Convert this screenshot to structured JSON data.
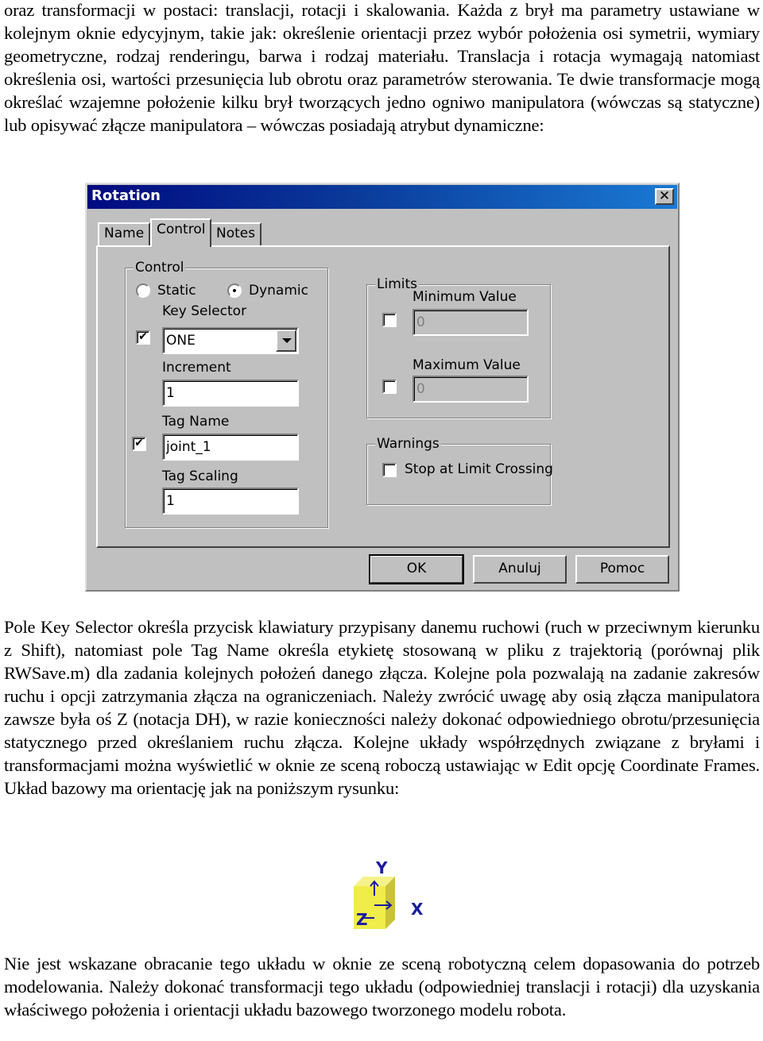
{
  "paragraphs": {
    "intro": "oraz transformacji w postaci: translacji, rotacji i skalowania. Każda z brył ma parametry ustawiane w kolejnym oknie edycyjnym, takie jak: określenie orientacji przez wybór położenia osi symetrii, wymiary geometryczne, rodzaj renderingu, barwa i rodzaj materiału. Translacja i rotacja wymagają natomiast określenia osi, wartości przesunięcia lub obrotu oraz parametrów sterowania. Te dwie transformacje mogą określać wzajemne położenie kilku brył tworzących jedno ogniwo manipulatora (wówczas są statyczne) lub opisywać złącze manipulatora – wówczas posiadają atrybut dynamiczne:",
    "key_selector": "Pole Key Selector określa przycisk klawiatury przypisany danemu ruchowi (ruch w przeciwnym kierunku z Shift), natomiast pole Tag Name określa etykietę stosowaną w pliku z trajektorią (porównaj plik RWSave.m) dla zadania kolejnych położeń danego złącza. Kolejne pola pozwalają na zadanie zakresów ruchu i opcji zatrzymania złącza na ograniczeniach. Należy zwrócić uwagę aby osią złącza manipulatora zawsze była oś Z (notacja DH), w razie konieczności należy dokonać odpowiedniego obrotu/przesunięcia statycznego przed określaniem ruchu złącza. Kolejne układy współrzędnych związane z bryłami i transformacjami można wyświetlić w oknie ze sceną roboczą ustawiając w Edit opcję Coordinate Frames. Układ bazowy ma orientację jak na poniższym rysunku:",
    "closing": "Nie jest wskazane obracanie tego układu w oknie ze sceną robotyczną celem dopasowania do potrzeb modelowania. Należy dokonać transformacji tego układu (odpowiedniej translacji i rotacji) dla uzyskania właściwego położenia i orientacji układu bazowego tworzonego modelu robota."
  },
  "dialog": {
    "title": "Rotation",
    "close_icon": "close-icon",
    "tabs": [
      {
        "label": "Name",
        "active": false
      },
      {
        "label": "Control",
        "active": true
      },
      {
        "label": "Notes",
        "active": false
      }
    ],
    "control_group": {
      "legend": "Control",
      "radio_static": {
        "label": "Static",
        "selected": false
      },
      "radio_dynamic": {
        "label": "Dynamic",
        "selected": true
      },
      "key_selector": {
        "label": "Key Selector",
        "checked": true,
        "value": "ONE"
      },
      "increment": {
        "label": "Increment",
        "value": "1"
      },
      "tag_name": {
        "label": "Tag Name",
        "checked": true,
        "value": "joint_1"
      },
      "tag_scaling": {
        "label": "Tag Scaling",
        "value": "1"
      }
    },
    "limits_group": {
      "legend": "Limits",
      "minimum": {
        "label": "Minimum Value",
        "checked": false,
        "value": "0"
      },
      "maximum": {
        "label": "Maximum Value",
        "checked": false,
        "value": "0"
      }
    },
    "warnings_group": {
      "legend": "Warnings",
      "stop_at_limit": {
        "label": "Stop at Limit Crossing",
        "checked": false
      }
    },
    "buttons": {
      "ok": "OK",
      "cancel": "Anuluj",
      "help": "Pomoc"
    },
    "check_mark": "✔",
    "close_glyph": "✕"
  },
  "axes_figure": {
    "x_label": "X",
    "y_label": "Y",
    "z_label": "Z",
    "cube_color": "#f0ec4a",
    "label_color": "#1a1aa0"
  },
  "colors": {
    "titlebar_start": "#000a80",
    "titlebar_end": "#1a7ad4",
    "dialog_face": "#c0c0c0"
  }
}
